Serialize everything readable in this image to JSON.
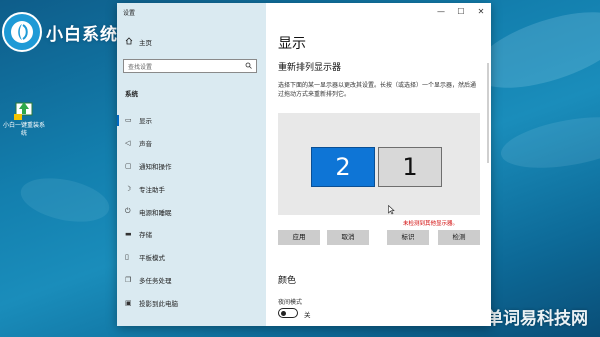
{
  "desktop": {
    "logo_text": "小白系统",
    "desktop_icon_label": "小白一键重装系统",
    "watermark": "单词易科技网"
  },
  "window": {
    "title": "设置",
    "controls": {
      "minimize": "—",
      "maximize": "☐",
      "close": "✕"
    }
  },
  "sidebar": {
    "home_label": "主页",
    "search_placeholder": "查找设置",
    "section_label": "系统",
    "items": [
      {
        "label": "显示",
        "icon": "monitor-icon",
        "active": true
      },
      {
        "label": "声音",
        "icon": "speaker-icon",
        "active": false
      },
      {
        "label": "通知和操作",
        "icon": "notification-icon",
        "active": false
      },
      {
        "label": "专注助手",
        "icon": "moon-icon",
        "active": false
      },
      {
        "label": "电源和睡眠",
        "icon": "power-icon",
        "active": false
      },
      {
        "label": "存储",
        "icon": "storage-icon",
        "active": false
      },
      {
        "label": "平板模式",
        "icon": "tablet-icon",
        "active": false
      },
      {
        "label": "多任务处理",
        "icon": "multitask-icon",
        "active": false
      },
      {
        "label": "投影到此电脑",
        "icon": "project-icon",
        "active": false
      }
    ]
  },
  "main": {
    "page_title": "显示",
    "section_title": "重新排列显示器",
    "description": "选择下面的某一显示器以更改其设置。长按（或选择）一个显示器，然后通过拖动方式来重新排列它。",
    "monitors": [
      {
        "number": "2",
        "selected": true
      },
      {
        "number": "1",
        "selected": false
      }
    ],
    "error_note": "未检测到其他显示器。",
    "buttons": {
      "apply": "应用",
      "cancel": "取消",
      "identify": "标识",
      "detect": "检测"
    },
    "color_section": "颜色",
    "night_light_label": "夜间模式",
    "night_light_state": "关"
  },
  "colors": {
    "accent": "#0e75d6",
    "error": "#d00000",
    "sidebar_bg": "#d7e8f0"
  }
}
